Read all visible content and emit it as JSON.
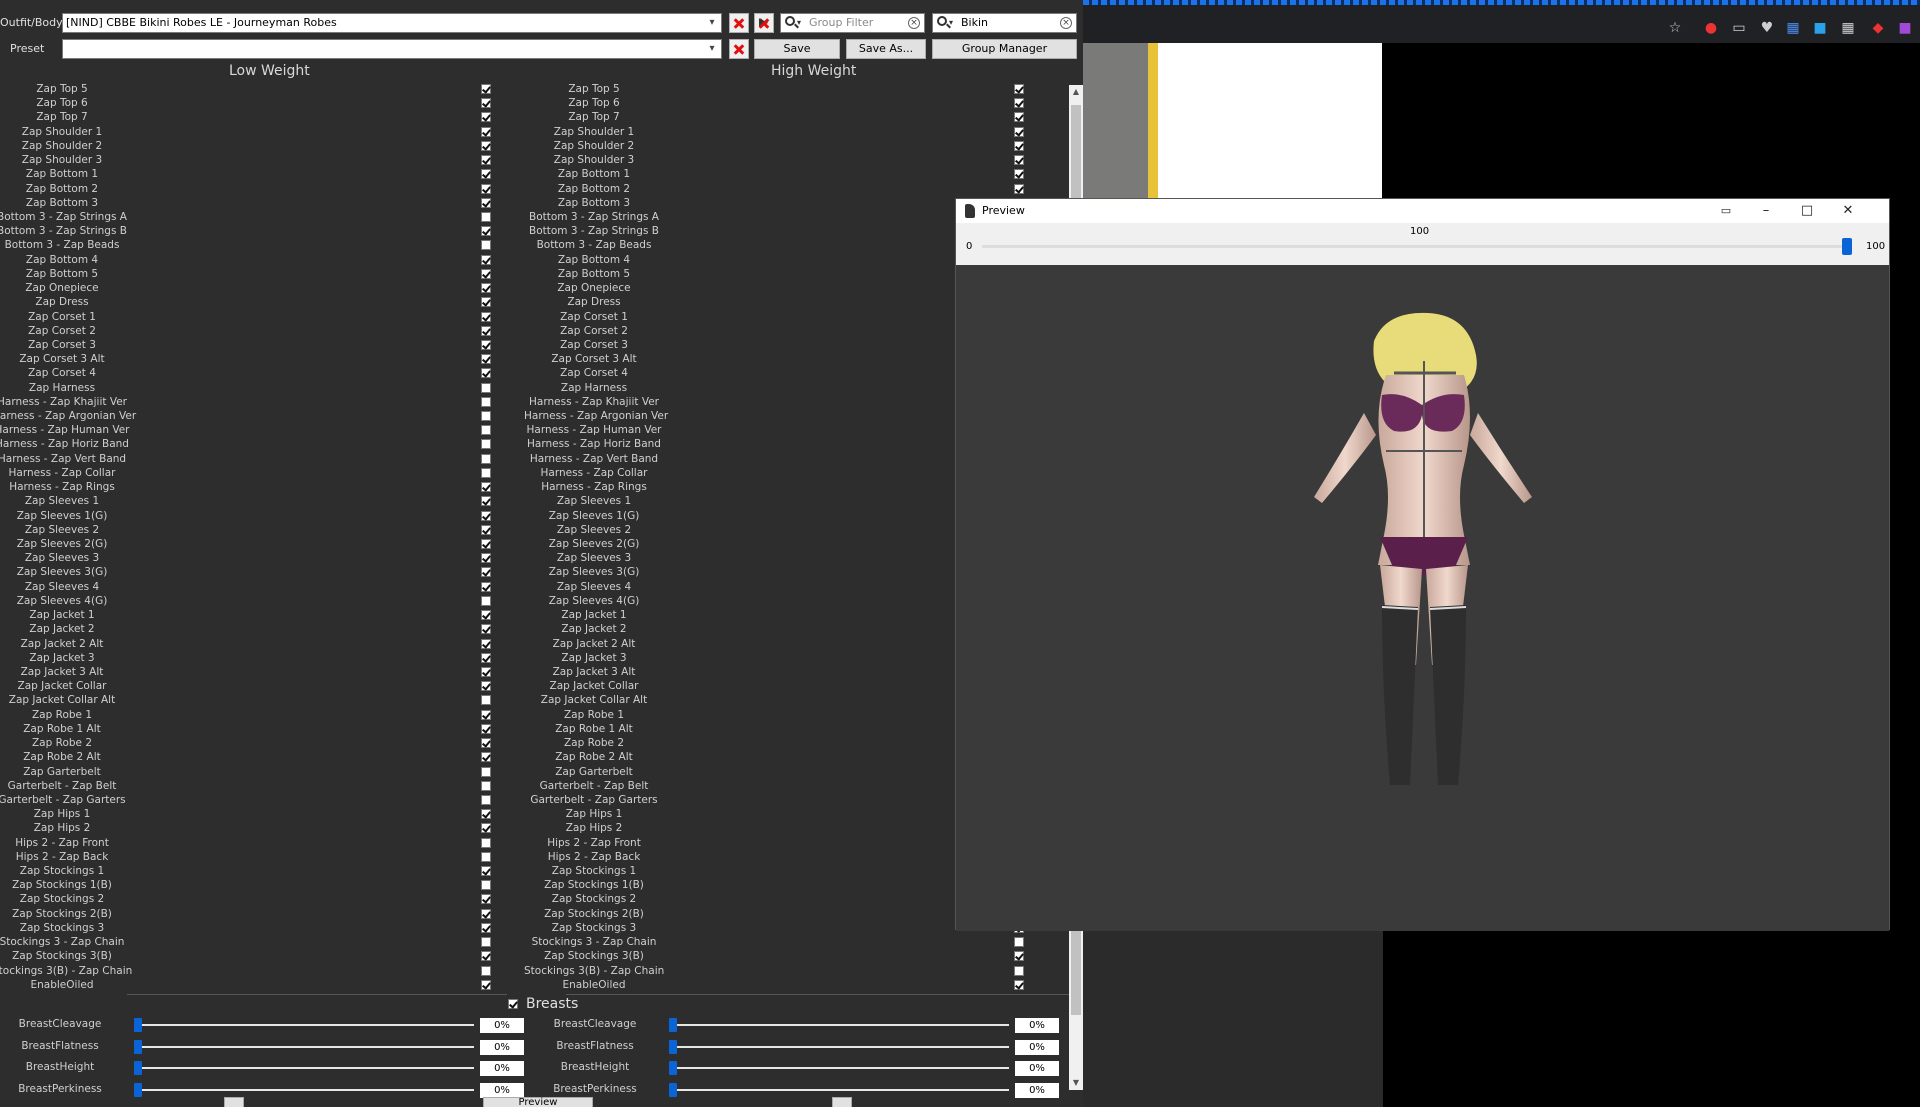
{
  "bodyslide": {
    "outfit_label": "Outfit/Body",
    "outfit_value": "[NIND] CBBE Bikini Robes LE - Journeyman Robes",
    "preset_label": "Preset",
    "preset_value": "",
    "save_label": "Save",
    "save_as_label": "Save As...",
    "group_manager_label": "Group Manager",
    "group_filter_placeholder": "Group Filter",
    "outfit_filter_value": "Bikin",
    "low_weight_label": "Low Weight",
    "high_weight_label": "High Weight",
    "zap_items": [
      "Zap Top 5",
      "Zap Top 6",
      "Zap Top 7",
      "Zap Shoulder 1",
      "Zap Shoulder 2",
      "Zap Shoulder 3",
      "Zap Bottom 1",
      "Zap Bottom 2",
      "Zap Bottom 3",
      "Bottom 3 - Zap Strings A",
      "Bottom 3 - Zap Strings B",
      "Bottom 3 - Zap Beads",
      "Zap Bottom 4",
      "Zap Bottom 5",
      "Zap Onepiece",
      "Zap Dress",
      "Zap Corset 1",
      "Zap Corset 2",
      "Zap Corset 3",
      "Zap Corset 3 Alt",
      "Zap Corset 4",
      "Zap Harness",
      "Harness - Zap Khajiit Ver",
      "Harness - Zap Argonian Ver",
      "Harness - Zap Human Ver",
      "Harness - Zap Horiz Band",
      "Harness - Zap Vert Band",
      "Harness - Zap Collar",
      "Harness - Zap Rings",
      "Zap Sleeves 1",
      "Zap Sleeves 1(G)",
      "Zap Sleeves 2",
      "Zap Sleeves 2(G)",
      "Zap Sleeves 3",
      "Zap Sleeves 3(G)",
      "Zap Sleeves 4",
      "Zap Sleeves 4(G)",
      "Zap Jacket 1",
      "Zap Jacket 2",
      "Zap Jacket 2 Alt",
      "Zap Jacket 3",
      "Zap Jacket 3 Alt",
      "Zap Jacket Collar",
      "Zap Jacket Collar Alt",
      "Zap Robe 1",
      "Zap Robe 1 Alt",
      "Zap Robe 2",
      "Zap Robe 2 Alt",
      "Zap Garterbelt",
      "Garterbelt - Zap Belt",
      "Garterbelt - Zap Garters",
      "Zap Hips 1",
      "Zap Hips 2",
      "Hips 2 - Zap Front",
      "Hips 2 - Zap Back",
      "Zap Stockings 1",
      "Zap Stockings 1(B)",
      "Zap Stockings 2",
      "Zap Stockings 2(B)",
      "Zap Stockings 3",
      "Stockings 3 - Zap Chain",
      "Zap Stockings 3(B)",
      "Stockings 3(B) - Zap Chain",
      "EnableOiled"
    ],
    "low_checked": [
      1,
      1,
      1,
      1,
      1,
      1,
      1,
      1,
      1,
      0,
      1,
      0,
      1,
      1,
      1,
      1,
      1,
      1,
      1,
      1,
      1,
      0,
      0,
      0,
      0,
      0,
      0,
      0,
      1,
      1,
      1,
      1,
      1,
      1,
      1,
      1,
      0,
      1,
      1,
      1,
      1,
      1,
      1,
      0,
      1,
      1,
      1,
      1,
      0,
      0,
      0,
      1,
      1,
      0,
      0,
      1,
      0,
      1,
      1,
      1,
      0,
      1,
      0,
      1
    ],
    "high_checked": [
      1,
      1,
      1,
      1,
      1,
      1,
      1,
      1,
      1,
      0,
      1,
      0,
      1,
      1,
      1,
      1,
      1,
      1,
      1,
      1,
      1,
      0,
      0,
      0,
      0,
      0,
      0,
      0,
      1,
      1,
      1,
      1,
      1,
      1,
      1,
      1,
      0,
      1,
      1,
      1,
      1,
      1,
      1,
      0,
      1,
      1,
      1,
      1,
      0,
      0,
      0,
      1,
      1,
      0,
      0,
      1,
      0,
      1,
      1,
      1,
      0,
      1,
      0,
      1
    ],
    "breasts_group_label": "Breasts",
    "sliders": [
      {
        "name": "BreastCleavage",
        "low": "0%",
        "high": "0%"
      },
      {
        "name": "BreastFlatness",
        "low": "0%",
        "high": "0%"
      },
      {
        "name": "BreastHeight",
        "low": "0%",
        "high": "0%"
      },
      {
        "name": "BreastPerkiness",
        "low": "0%",
        "high": "0%"
      }
    ],
    "preview_button_label": "Preview"
  },
  "preview_window": {
    "title": "Preview",
    "slider_value": "100",
    "slider_min": "0",
    "slider_max": "100",
    "slider_fraction": 1.0
  },
  "colors": {
    "app_bg": "#2d2d2d",
    "accent": "#0a64d6",
    "delete_red": "#e01010"
  }
}
